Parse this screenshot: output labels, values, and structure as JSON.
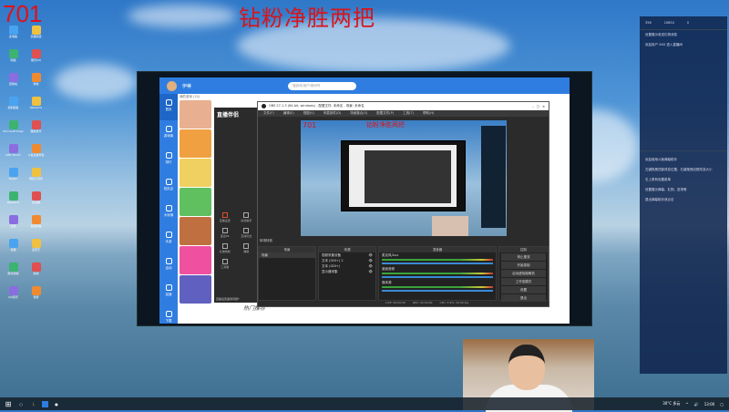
{
  "overlay": {
    "counter": "701",
    "banner": "钻粉净胜两把"
  },
  "desktop_icons": [
    "此电脑",
    "英雄联盟",
    "网络",
    "腾讯QQ",
    "回收站",
    "微信",
    "控制面板",
    "WeGame",
    "Microsoft Edge",
    "酷狗音乐",
    "OBS Studio",
    "斗鱼直播伴侣",
    "Steam",
    "网易云音乐",
    "WeGame",
    "加速器",
    "迅雷",
    "百度网盘",
    "优酷",
    "爱奇艺",
    "腾讯视频",
    "剪映",
    "QQ音乐",
    "录屏"
  ],
  "app": {
    "user": "伊蒂",
    "search_placeholder": "搜游戏/用户/房间号",
    "sidebar": [
      "首页",
      "游戏库",
      "排行",
      "找队友",
      "大玩咖",
      "手游",
      "活动",
      "加速",
      "下载"
    ],
    "section": "我的游戏 (22)",
    "hot": "热门推荐"
  },
  "companion": {
    "logo": "直播伴侣",
    "tools": [
      "直播设置",
      "房管助手",
      "连麦PK",
      "互动玩法",
      "礼物特效",
      "弹幕",
      "工具箱"
    ],
    "notice": "直播设置遇到问题?"
  },
  "obs": {
    "title": "OBS 27.1.3 (64-bit, windows) - 配置文件: 未命名 - 场景: 未命名",
    "menu": [
      "文件(F)",
      "编辑(E)",
      "视图(V)",
      "停靠部件(D)",
      "场景集合(S)",
      "配置文件(P)",
      "工具(T)",
      "帮助(H)"
    ],
    "transition": "转场特效",
    "scenes_header": "场景",
    "scenes": [
      "场景"
    ],
    "sources_header": "来源",
    "sources": [
      "视频采集设备",
      "文本 (GDI+) 2",
      "文本 (GDI+)",
      "显示器采集"
    ],
    "mixer_header": "混音器",
    "mixer": [
      "麦克风/Aux",
      "桌面音频",
      "媒体源"
    ],
    "controls_header": "控制",
    "controls": [
      "停止推流",
      "开始录制",
      "启动虚拟摄像机",
      "工作室模式",
      "设置",
      "退出"
    ],
    "status": [
      "LIVE: 00:00:00",
      "REC: 00:00:00",
      "CPU: 3.9%, 30.00 fps"
    ]
  },
  "panel": {
    "stats": [
      "356",
      "10854",
      "0"
    ],
    "lines1": [
      "设置展示收送礼物消息",
      "欢迎用户 XXX 进入直播间"
    ],
    "lines2": [
      "欢迎使用斗鱼弹幕助手",
      "左键拖拽顶部改变位置，右键拖拽边框改变大小",
      "右上角有设置菜单",
      "设置展示弹幕、礼物、进场等",
      "退出弹幕助手请点击"
    ]
  },
  "taskbar": {
    "weather": "30°C 多云",
    "time": "13:00"
  }
}
